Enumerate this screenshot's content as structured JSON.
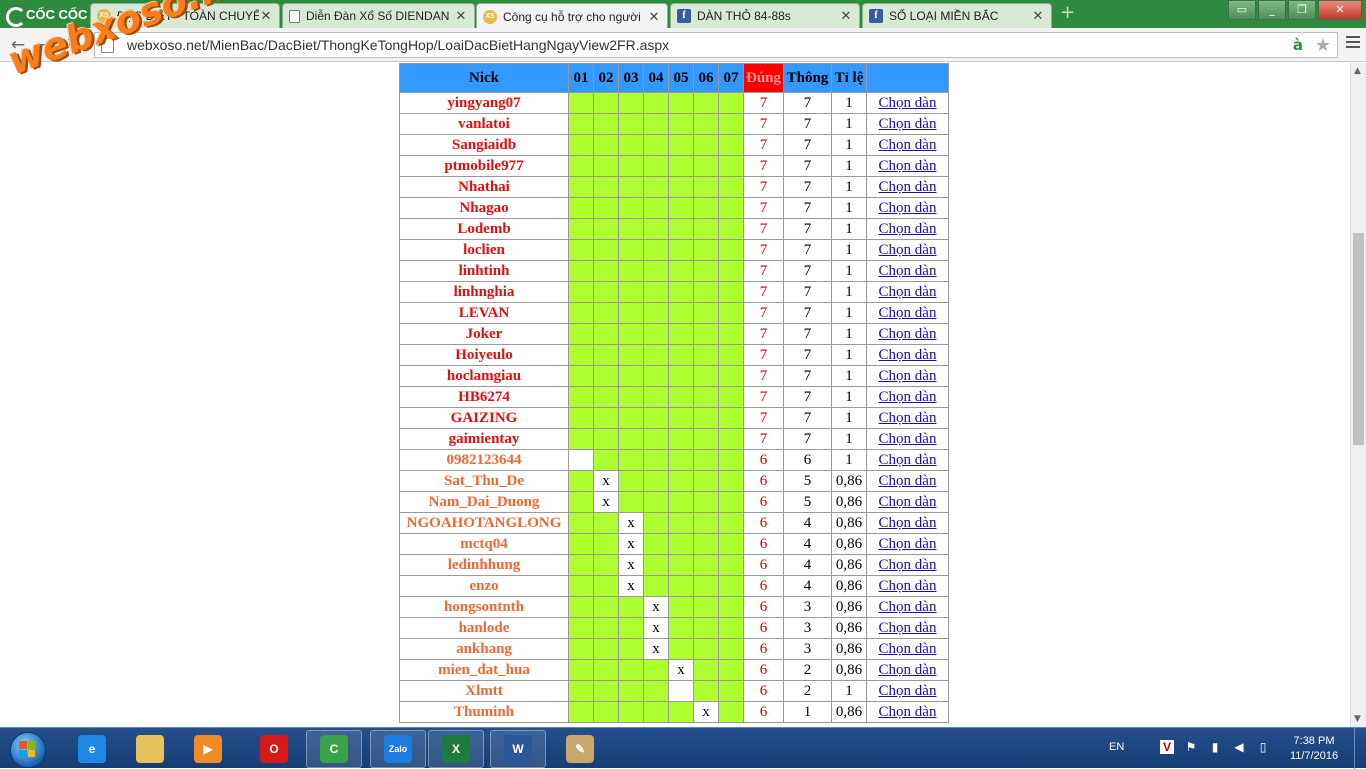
{
  "browser": {
    "brand": "CỐC CỐC",
    "tabs": [
      {
        "label": "ĐẶC BIỆT - TOÀN CHUYÊN",
        "icon": "xs",
        "active": false
      },
      {
        "label": "Diễn Đàn Xổ Số DIENDAN",
        "icon": "doc",
        "active": false
      },
      {
        "label": "Công cụ hỗ trợ cho người",
        "icon": "xs",
        "active": true
      },
      {
        "label": "DÀN THỎ 84-88s",
        "icon": "fb",
        "active": false
      },
      {
        "label": "SỐ LOẠI MIỀN BẮC",
        "icon": "fb",
        "active": false
      }
    ],
    "url": "webxoso.net/MienBac/DacBiet/ThongKeTongHop/LoaiDacBietHangNgayView2FR.aspx",
    "watermark": "webxoso.net"
  },
  "table": {
    "headers": {
      "nick": "Nick",
      "days": [
        "01",
        "02",
        "03",
        "04",
        "05",
        "06",
        "07"
      ],
      "dung": "Đúng",
      "thong": "Thông",
      "tile": "Tỉ lệ"
    },
    "rows": [
      {
        "nick": "yingyang07",
        "color": "red",
        "cells": [
          "g",
          "g",
          "g",
          "g",
          "g",
          "g",
          "g"
        ],
        "dung": "7",
        "thong": "7",
        "tile": "1",
        "link": "Chọn dàn"
      },
      {
        "nick": "vanlatoi",
        "color": "red",
        "cells": [
          "g",
          "g",
          "g",
          "g",
          "g",
          "g",
          "g"
        ],
        "dung": "7",
        "thong": "7",
        "tile": "1",
        "link": "Chọn dàn"
      },
      {
        "nick": "Sangiaidb",
        "color": "red",
        "cells": [
          "g",
          "g",
          "g",
          "g",
          "g",
          "g",
          "g"
        ],
        "dung": "7",
        "thong": "7",
        "tile": "1",
        "link": "Chọn dàn"
      },
      {
        "nick": "ptmobile977",
        "color": "red",
        "cells": [
          "g",
          "g",
          "g",
          "g",
          "g",
          "g",
          "g"
        ],
        "dung": "7",
        "thong": "7",
        "tile": "1",
        "link": "Chọn dàn"
      },
      {
        "nick": "Nhathai",
        "color": "red",
        "cells": [
          "g",
          "g",
          "g",
          "g",
          "g",
          "g",
          "g"
        ],
        "dung": "7",
        "thong": "7",
        "tile": "1",
        "link": "Chọn dàn"
      },
      {
        "nick": "Nhagao",
        "color": "red",
        "cells": [
          "g",
          "g",
          "g",
          "g",
          "g",
          "g",
          "g"
        ],
        "dung": "7",
        "thong": "7",
        "tile": "1",
        "link": "Chọn dàn"
      },
      {
        "nick": "Lodemb",
        "color": "red",
        "cells": [
          "g",
          "g",
          "g",
          "g",
          "g",
          "g",
          "g"
        ],
        "dung": "7",
        "thong": "7",
        "tile": "1",
        "link": "Chọn dàn"
      },
      {
        "nick": "loclien",
        "color": "red",
        "cells": [
          "g",
          "g",
          "g",
          "g",
          "g",
          "g",
          "g"
        ],
        "dung": "7",
        "thong": "7",
        "tile": "1",
        "link": "Chọn dàn"
      },
      {
        "nick": "linhtinh",
        "color": "red",
        "cells": [
          "g",
          "g",
          "g",
          "g",
          "g",
          "g",
          "g"
        ],
        "dung": "7",
        "thong": "7",
        "tile": "1",
        "link": "Chọn dàn"
      },
      {
        "nick": "linhnghia",
        "color": "red",
        "cells": [
          "g",
          "g",
          "g",
          "g",
          "g",
          "g",
          "g"
        ],
        "dung": "7",
        "thong": "7",
        "tile": "1",
        "link": "Chọn dàn"
      },
      {
        "nick": "LEVAN",
        "color": "red",
        "cells": [
          "g",
          "g",
          "g",
          "g",
          "g",
          "g",
          "g"
        ],
        "dung": "7",
        "thong": "7",
        "tile": "1",
        "link": "Chọn dàn"
      },
      {
        "nick": "Joker",
        "color": "red",
        "cells": [
          "g",
          "g",
          "g",
          "g",
          "g",
          "g",
          "g"
        ],
        "dung": "7",
        "thong": "7",
        "tile": "1",
        "link": "Chọn dàn"
      },
      {
        "nick": "Hoiyeulo",
        "color": "red",
        "cells": [
          "g",
          "g",
          "g",
          "g",
          "g",
          "g",
          "g"
        ],
        "dung": "7",
        "thong": "7",
        "tile": "1",
        "link": "Chọn dàn"
      },
      {
        "nick": "hoclamgiau",
        "color": "red",
        "cells": [
          "g",
          "g",
          "g",
          "g",
          "g",
          "g",
          "g"
        ],
        "dung": "7",
        "thong": "7",
        "tile": "1",
        "link": "Chọn dàn"
      },
      {
        "nick": "HB6274",
        "color": "red",
        "cells": [
          "g",
          "g",
          "g",
          "g",
          "g",
          "g",
          "g"
        ],
        "dung": "7",
        "thong": "7",
        "tile": "1",
        "link": "Chọn dàn"
      },
      {
        "nick": "GAIZING",
        "color": "red",
        "cells": [
          "g",
          "g",
          "g",
          "g",
          "g",
          "g",
          "g"
        ],
        "dung": "7",
        "thong": "7",
        "tile": "1",
        "link": "Chọn dàn"
      },
      {
        "nick": "gaimientay",
        "color": "red",
        "cells": [
          "g",
          "g",
          "g",
          "g",
          "g",
          "g",
          "g"
        ],
        "dung": "7",
        "thong": "7",
        "tile": "1",
        "link": "Chọn dàn"
      },
      {
        "nick": "0982123644",
        "color": "orange",
        "cells": [
          "e",
          "g",
          "g",
          "g",
          "g",
          "g",
          "g"
        ],
        "dung": "6",
        "thong": "6",
        "tile": "1",
        "link": "Chọn dàn"
      },
      {
        "nick": "Sat_Thu_De",
        "color": "orange",
        "cells": [
          "g",
          "x",
          "g",
          "g",
          "g",
          "g",
          "g"
        ],
        "dung": "6",
        "thong": "5",
        "tile": "0,86",
        "link": "Chọn dàn"
      },
      {
        "nick": "Nam_Dai_Duong",
        "color": "orange",
        "cells": [
          "g",
          "x",
          "g",
          "g",
          "g",
          "g",
          "g"
        ],
        "dung": "6",
        "thong": "5",
        "tile": "0,86",
        "link": "Chọn dàn"
      },
      {
        "nick": "NGOAHOTANGLONG",
        "color": "orange",
        "cells": [
          "g",
          "g",
          "x",
          "g",
          "g",
          "g",
          "g"
        ],
        "dung": "6",
        "thong": "4",
        "tile": "0,86",
        "link": "Chọn dàn"
      },
      {
        "nick": "mctq04",
        "color": "orange",
        "cells": [
          "g",
          "g",
          "x",
          "g",
          "g",
          "g",
          "g"
        ],
        "dung": "6",
        "thong": "4",
        "tile": "0,86",
        "link": "Chọn dàn"
      },
      {
        "nick": "ledinhhung",
        "color": "orange",
        "cells": [
          "g",
          "g",
          "x",
          "g",
          "g",
          "g",
          "g"
        ],
        "dung": "6",
        "thong": "4",
        "tile": "0,86",
        "link": "Chọn dàn"
      },
      {
        "nick": "enzo",
        "color": "orange",
        "cells": [
          "g",
          "g",
          "x",
          "g",
          "g",
          "g",
          "g"
        ],
        "dung": "6",
        "thong": "4",
        "tile": "0,86",
        "link": "Chọn dàn"
      },
      {
        "nick": "hongsontnth",
        "color": "orange",
        "cells": [
          "g",
          "g",
          "g",
          "x",
          "g",
          "g",
          "g"
        ],
        "dung": "6",
        "thong": "3",
        "tile": "0,86",
        "link": "Chọn dàn"
      },
      {
        "nick": "hanlode",
        "color": "orange",
        "cells": [
          "g",
          "g",
          "g",
          "x",
          "g",
          "g",
          "g"
        ],
        "dung": "6",
        "thong": "3",
        "tile": "0,86",
        "link": "Chọn dàn"
      },
      {
        "nick": "ankhang",
        "color": "orange",
        "cells": [
          "g",
          "g",
          "g",
          "x",
          "g",
          "g",
          "g"
        ],
        "dung": "6",
        "thong": "3",
        "tile": "0,86",
        "link": "Chọn dàn"
      },
      {
        "nick": "mien_dat_hua",
        "color": "orange",
        "cells": [
          "g",
          "g",
          "g",
          "g",
          "x",
          "g",
          "g"
        ],
        "dung": "6",
        "thong": "2",
        "tile": "0,86",
        "link": "Chọn dàn"
      },
      {
        "nick": "Xlmtt",
        "color": "orange",
        "cells": [
          "g",
          "g",
          "g",
          "g",
          "e",
          "g",
          "g"
        ],
        "dung": "6",
        "thong": "2",
        "tile": "1",
        "link": "Chọn dàn"
      },
      {
        "nick": "Thuminh",
        "color": "orange",
        "cells": [
          "g",
          "g",
          "g",
          "g",
          "g",
          "x",
          "g"
        ],
        "dung": "6",
        "thong": "1",
        "tile": "0,86",
        "link": "Chọn dàn"
      }
    ],
    "mark": "x"
  },
  "taskbar": {
    "apps": [
      {
        "name": "internet-explorer-icon",
        "glyph": "e",
        "color": "#1e88e5"
      },
      {
        "name": "file-explorer-icon",
        "glyph": "",
        "color": "#e8c25a"
      },
      {
        "name": "media-player-icon",
        "glyph": "▶",
        "color": "#f08a24"
      },
      {
        "name": "opera-icon",
        "glyph": "O",
        "color": "#d61a1a"
      },
      {
        "name": "coccoc-icon",
        "glyph": "C",
        "color": "#3aa349"
      },
      {
        "name": "zalo-icon",
        "glyph": "Zalo",
        "color": "#1b7de2"
      },
      {
        "name": "excel-icon",
        "glyph": "X",
        "color": "#1f7a3d"
      },
      {
        "name": "word-icon",
        "glyph": "W",
        "color": "#2b5797"
      },
      {
        "name": "paint-icon",
        "glyph": "✎",
        "color": "#c9a76a"
      }
    ],
    "lang": "EN",
    "time": "7:38 PM",
    "date": "11/7/2016"
  }
}
